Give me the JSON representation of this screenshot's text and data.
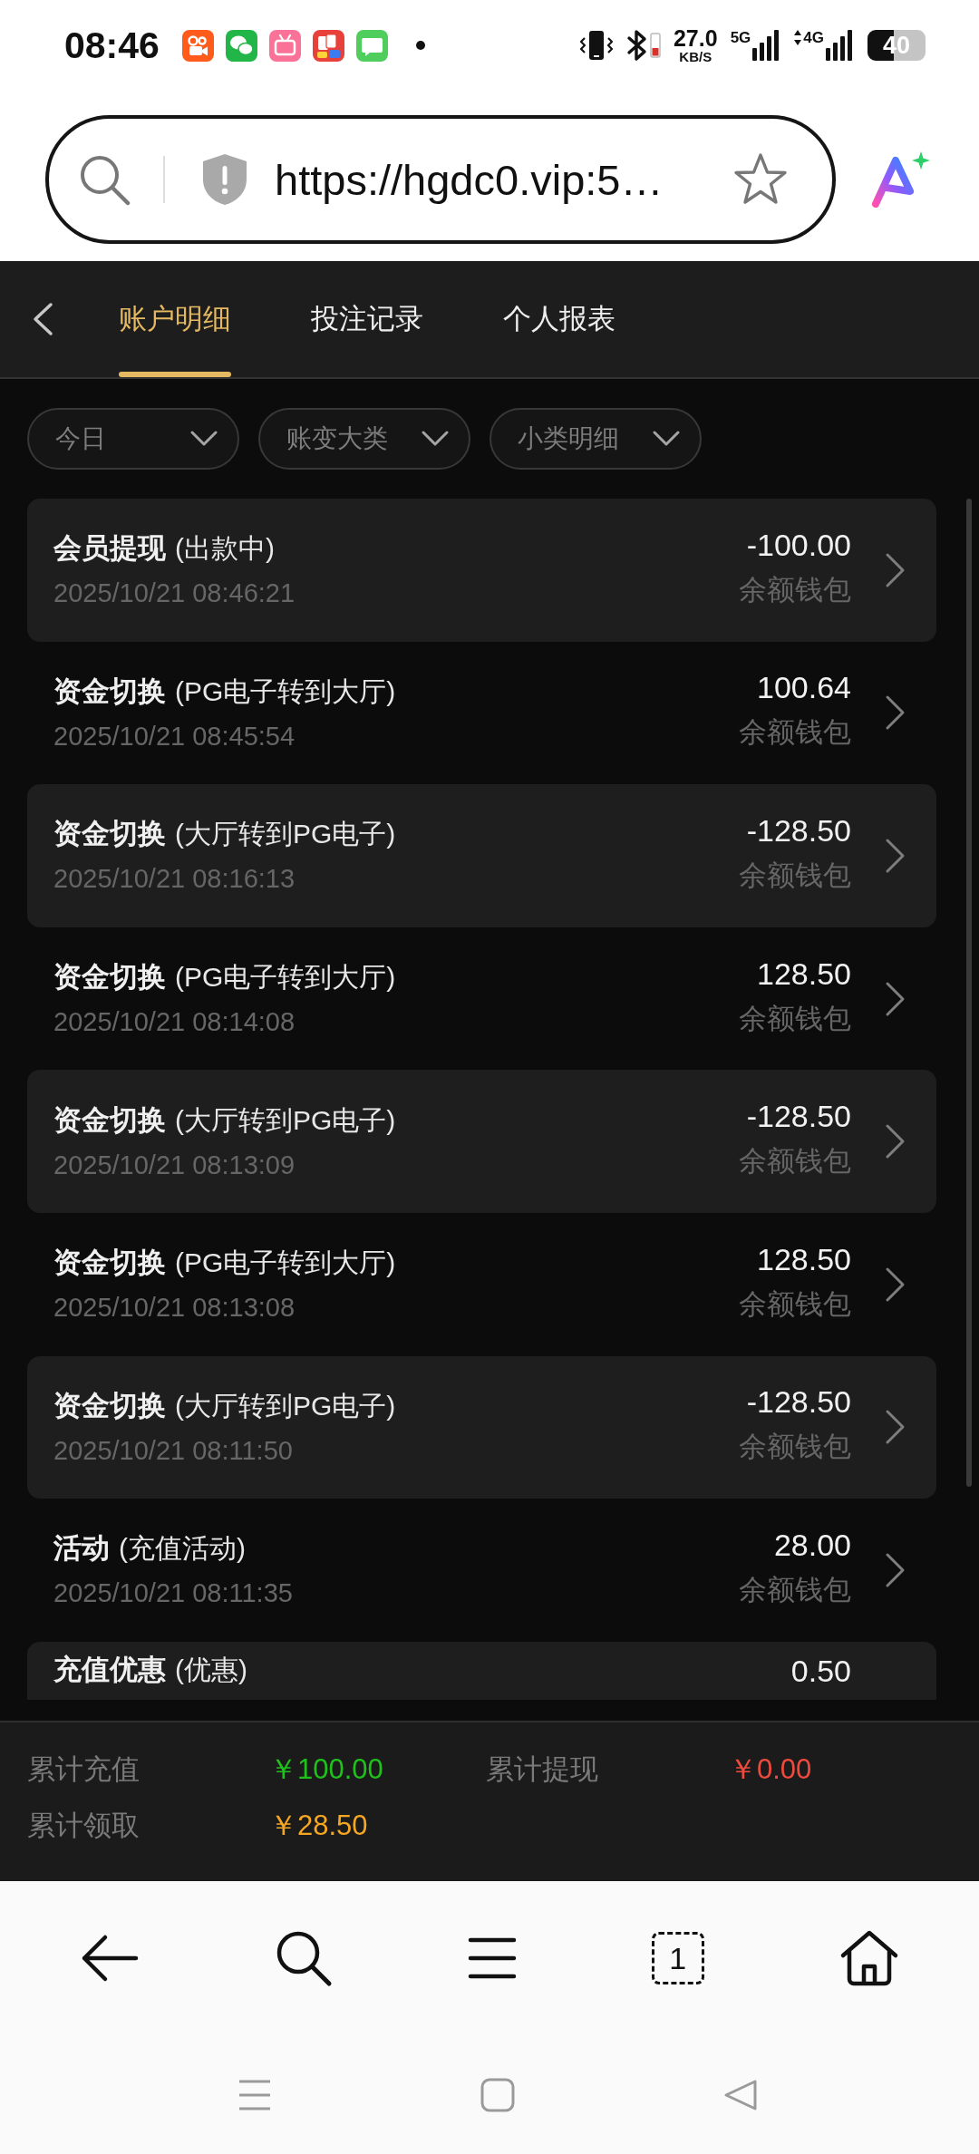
{
  "status_bar": {
    "time": "08:46",
    "network_speed": "27.0",
    "network_speed_unit": "KB/S",
    "signals": [
      {
        "label": "5G",
        "kind": "plain"
      },
      {
        "label": "4G",
        "kind": "data"
      }
    ],
    "battery": "40"
  },
  "address_bar": {
    "url": "https://hgdc0.vip:5…"
  },
  "header": {
    "tabs": [
      {
        "label": "账户明细",
        "selected": true
      },
      {
        "label": "投注记录",
        "selected": false
      },
      {
        "label": "个人报表",
        "selected": false
      }
    ]
  },
  "filters": [
    {
      "label": "今日"
    },
    {
      "label": "账变大类"
    },
    {
      "label": "小类明细"
    }
  ],
  "transactions": [
    {
      "title": "会员提现",
      "note": "(出款中)",
      "time": "2025/10/21 08:46:21",
      "amount": "-100.00",
      "wallet": "余额钱包"
    },
    {
      "title": "资金切换",
      "note": "(PG电子转到大厅)",
      "time": "2025/10/21 08:45:54",
      "amount": "100.64",
      "wallet": "余额钱包"
    },
    {
      "title": "资金切换",
      "note": "(大厅转到PG电子)",
      "time": "2025/10/21 08:16:13",
      "amount": "-128.50",
      "wallet": "余额钱包"
    },
    {
      "title": "资金切换",
      "note": "(PG电子转到大厅)",
      "time": "2025/10/21 08:14:08",
      "amount": "128.50",
      "wallet": "余额钱包"
    },
    {
      "title": "资金切换",
      "note": "(大厅转到PG电子)",
      "time": "2025/10/21 08:13:09",
      "amount": "-128.50",
      "wallet": "余额钱包"
    },
    {
      "title": "资金切换",
      "note": "(PG电子转到大厅)",
      "time": "2025/10/21 08:13:08",
      "amount": "128.50",
      "wallet": "余额钱包"
    },
    {
      "title": "资金切换",
      "note": "(大厅转到PG电子)",
      "time": "2025/10/21 08:11:50",
      "amount": "-128.50",
      "wallet": "余额钱包"
    },
    {
      "title": "活动",
      "note": "(充值活动)",
      "time": "2025/10/21 08:11:35",
      "amount": "28.00",
      "wallet": "余额钱包"
    },
    {
      "title": "充值优惠",
      "note": "(优惠)",
      "amount": "0.50"
    }
  ],
  "summary": [
    {
      "label": "累计充值",
      "value": "￥100.00",
      "color": "#1fc21a"
    },
    {
      "label": "累计提现",
      "value": "￥0.00",
      "color": "#ee4b3e"
    },
    {
      "label": "累计领取",
      "value": "￥28.50",
      "color": "#f5a623"
    }
  ],
  "browser_toolbar": {
    "tab_count": "1"
  }
}
